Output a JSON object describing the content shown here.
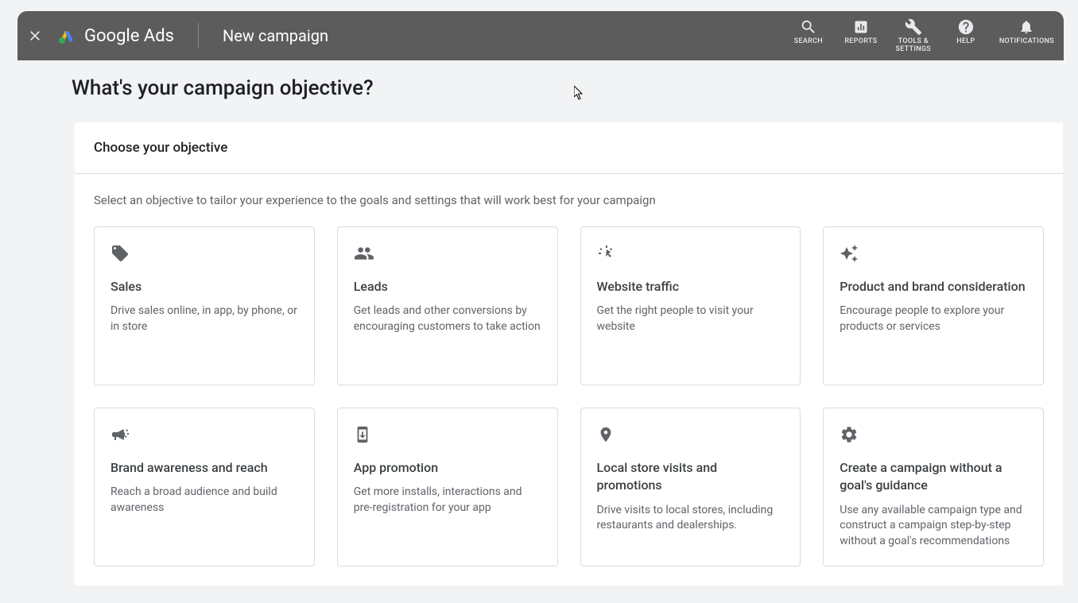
{
  "header": {
    "logo_text": "Google Ads",
    "page_name": "New campaign",
    "actions": [
      {
        "label": "SEARCH"
      },
      {
        "label": "REPORTS"
      },
      {
        "label": "TOOLS &\nSETTINGS"
      },
      {
        "label": "HELP"
      },
      {
        "label": "NOTIFICATIONS"
      }
    ]
  },
  "page_title": "What's your campaign objective?",
  "card": {
    "header_title": "Choose your objective",
    "help_text": "Select an objective to tailor your experience to the goals and settings that will work best for your campaign"
  },
  "objectives": [
    {
      "title": "Sales",
      "desc": "Drive sales online, in app, by phone, or in store"
    },
    {
      "title": "Leads",
      "desc": "Get leads and other conversions by encouraging customers to take action"
    },
    {
      "title": "Website traffic",
      "desc": "Get the right people to visit your website"
    },
    {
      "title": "Product and brand consideration",
      "desc": "Encourage people to explore your products or services"
    },
    {
      "title": "Brand awareness and reach",
      "desc": "Reach a broad audience and build awareness"
    },
    {
      "title": "App promotion",
      "desc": "Get more installs, interactions and pre-registration for your app"
    },
    {
      "title": "Local store visits and promotions",
      "desc": "Drive visits to local stores, including restaurants and dealerships."
    },
    {
      "title": "Create a campaign without a goal's guidance",
      "desc": "Use any available campaign type and construct a campaign step-by-step without a goal's recommendations"
    }
  ]
}
